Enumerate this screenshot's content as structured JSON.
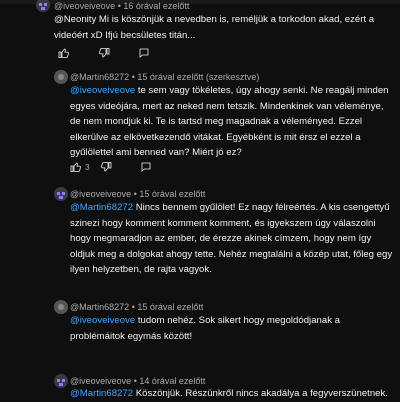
{
  "comments": [
    {
      "author": "@iveoveiveove",
      "time": "16 órával ezelőtt",
      "mention": "",
      "text": "@Neonity Mi is köszönjük a nevedben is, reméljük a torkodon akad, ezért a videóért xD Ifjú becsületes titán..."
    },
    {
      "author": "@Martin68272",
      "time": "15 órával ezelőtt (szerkesztve)",
      "mention": "@iveoveiveove",
      "text": " te sem vagy tökéletes, úgy ahogy senki. Ne reagálj minden egyes videójára, mert az neked nem tetszik. Mindenkinek van véleménye, de nem mondjuk ki. Te is tartsd meg magadnak a véleményed. Ezzel elkerülve az elkövetkezendő vitákat. Egyébként is mit érsz el ezzel a gyűlölettel ami benned van? Miért jó ez?",
      "likes": "3"
    },
    {
      "author": "@iveoveiveove",
      "time": "15 órával ezelőtt",
      "mention": "@Martin68272",
      "text": " Nincs bennem gyűlölet! Ez nagy félreértés. A kis csengettyű szinezi hogy komment komment komment, és igyekszem úgy válaszolni hogy megmaradjon az ember, de érezze akinek címzem, hogy nem így oldjuk meg a dolgokat ahogy tette. Nehéz megtalálni a közép utat, főleg egy ilyen helyzetben, de rajta vagyok."
    },
    {
      "author": "@Martin68272",
      "time": "15 órával ezelőtt",
      "mention": "@iveoveiveove",
      "text": " tudom nehéz. Sok sikert hogy megoldódjanak a problémáitok egymás között!"
    },
    {
      "author": "@iveoveiveove",
      "time": "14 órával ezelőtt",
      "mention": "@Martin68272",
      "text": " Köszönjük. Részünkről nincs akadálya a fegyverszünetnek."
    }
  ],
  "separator": "•",
  "icons": {
    "like": "thumbs-up-icon",
    "dislike": "thumbs-down-icon",
    "reply": "reply-icon"
  }
}
